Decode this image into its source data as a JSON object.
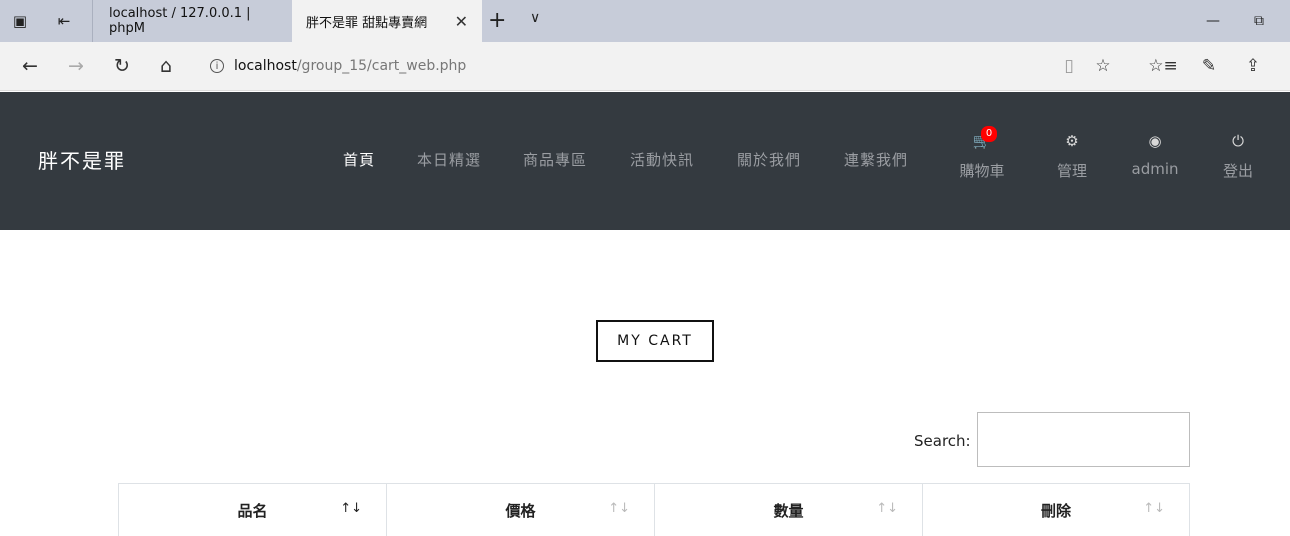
{
  "browser": {
    "tabs": [
      {
        "title": "localhost / 127.0.0.1 | phpM",
        "active": false
      },
      {
        "title": "胖不是罪 甜點專賣網",
        "active": true
      }
    ],
    "url_host": "localhost",
    "url_path": "/group_15/cart_web.php",
    "icons": {
      "tab_sys_1": "▣",
      "tab_sys_2": "⇤",
      "tab_close": "✕",
      "new_tab": "+",
      "tab_menu": "∨",
      "minimize": "—",
      "restore": "⧉",
      "back": "←",
      "forward": "→",
      "refresh": "↻",
      "home": "⌂",
      "info": "i",
      "reading_view": "▯",
      "favorite": "☆",
      "favorites_bar": "☆≡",
      "notes": "✎",
      "share": "⇪"
    }
  },
  "navbar": {
    "brand": "胖不是罪",
    "links": [
      {
        "label": "首頁",
        "active": true
      },
      {
        "label": "本日精選",
        "active": false
      },
      {
        "label": "商品專區",
        "active": false
      },
      {
        "label": "活動快訊",
        "active": false
      },
      {
        "label": "關於我們",
        "active": false
      },
      {
        "label": "連繫我們",
        "active": false
      }
    ],
    "cart": {
      "label": "購物車",
      "count": "0",
      "icon": "🛒"
    },
    "manage": {
      "label": "管理",
      "icon": "⚙"
    },
    "user": {
      "label": "admin",
      "icon": "◉"
    },
    "logout": {
      "label": "登出",
      "icon": "⏻"
    }
  },
  "main": {
    "title": "MY CART",
    "search_label": "Search:",
    "search_value": "",
    "columns": [
      {
        "label": "品名",
        "sort": "↑↓",
        "active": true
      },
      {
        "label": "價格",
        "sort": "↑↓",
        "active": false
      },
      {
        "label": "數量",
        "sort": "↑↓",
        "active": false
      },
      {
        "label": "刪除",
        "sort": "↑↓",
        "active": false
      }
    ]
  },
  "colors": {
    "navbar_bg": "#343a40",
    "nav_link": "#9a9da2",
    "nav_active": "#ffffff",
    "badge": "#ff0000"
  }
}
